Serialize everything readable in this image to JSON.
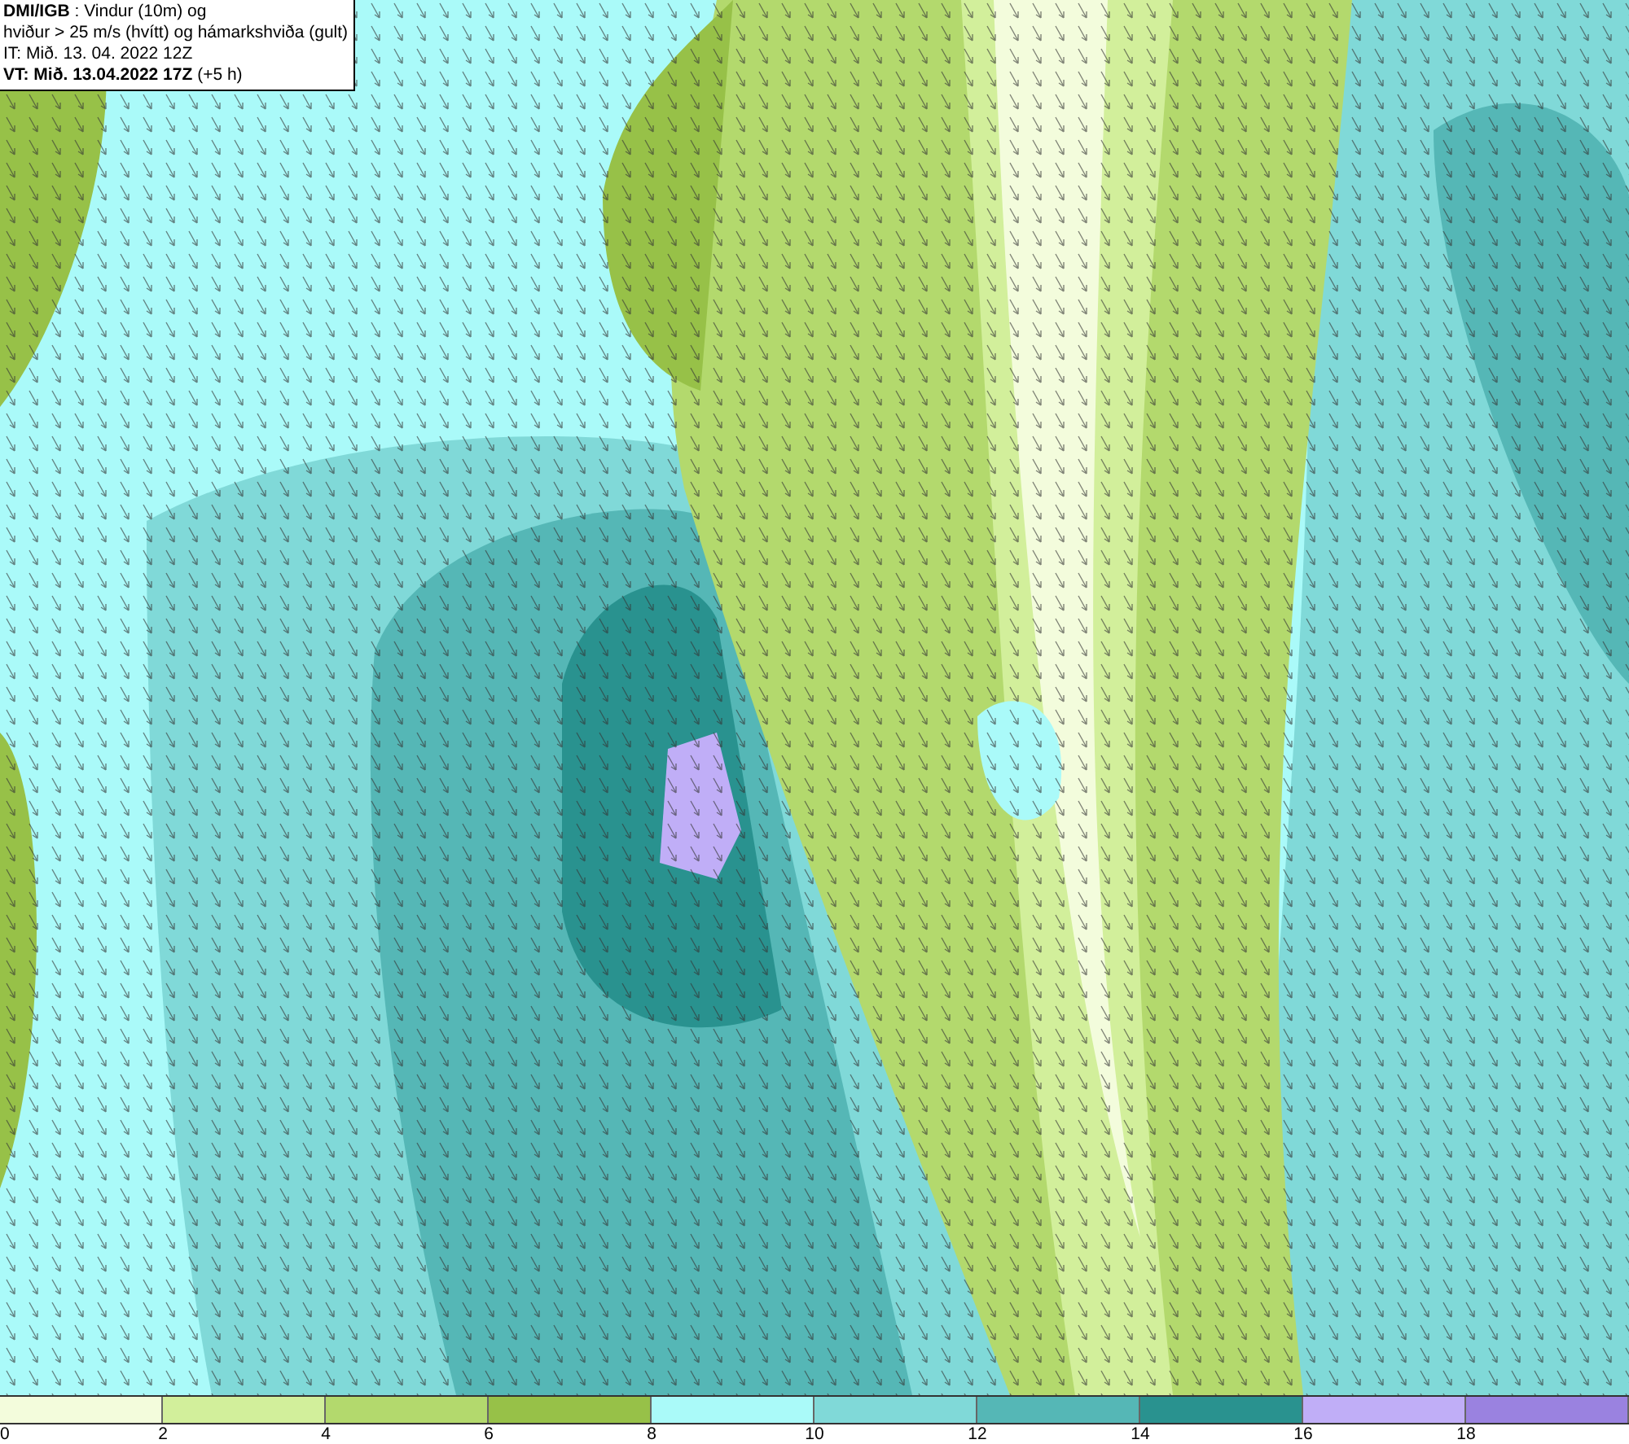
{
  "legend": {
    "title": "**DMI/IGB** : Vindur (10m) og",
    "subtitle": "hviður > 25 m/s (hvítt) og hámarkshviða (gult)",
    "issue_time": "IT: Mið. 13. 04. 2022 12Z",
    "valid_time": "**VT: Mið. 13.04.2022 17Z** (+5 h)"
  },
  "colorbar": {
    "swatches": [
      {
        "color": "#f3fcdc"
      },
      {
        "color": "#d2ef9b"
      },
      {
        "color": "#b3d96d"
      },
      {
        "color": "#97c148"
      },
      {
        "color": "#aafaf9"
      },
      {
        "color": "#80d9d8"
      },
      {
        "color": "#55b7b6"
      },
      {
        "color": "#29928f"
      },
      {
        "color": "#c0aef7"
      },
      {
        "color": "#9a82e0"
      }
    ],
    "ticks": [
      "0",
      "2",
      "4",
      "6",
      "8",
      "10",
      "12",
      "14",
      "16",
      "18"
    ]
  }
}
